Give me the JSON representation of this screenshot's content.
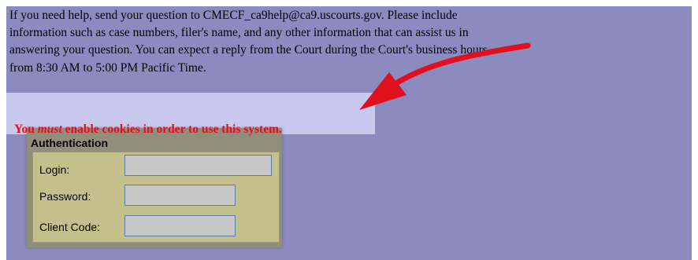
{
  "help": {
    "lines": [
      "If you need help, send your question to CMECF_ca9help@ca9.uscourts.gov. Please include",
      "information such as case numbers, filer's name, and any other information that can assist us in",
      "answering your question. You can expect a reply from the Court during the Court's business hours,",
      "from 8:30 AM to 5:00 PM Pacific Time."
    ]
  },
  "cookie_warning": {
    "before": "You ",
    "emphasis": "must",
    "after": " enable cookies in order to use this system."
  },
  "auth": {
    "title": "Authentication",
    "login_label": "Login:",
    "login_value": "",
    "password_label": "Password:",
    "password_value": "",
    "client_code_label": "Client Code:",
    "client_code_value": ""
  },
  "colors": {
    "panel_background": "#8b8bbf",
    "warning_text": "#e0101c",
    "warning_band": "#c9c9f0",
    "auth_box": "#c4c08c",
    "arrow": "#e0101c"
  },
  "icons": {
    "annotation_arrow": "curved-red-arrow-icon"
  }
}
